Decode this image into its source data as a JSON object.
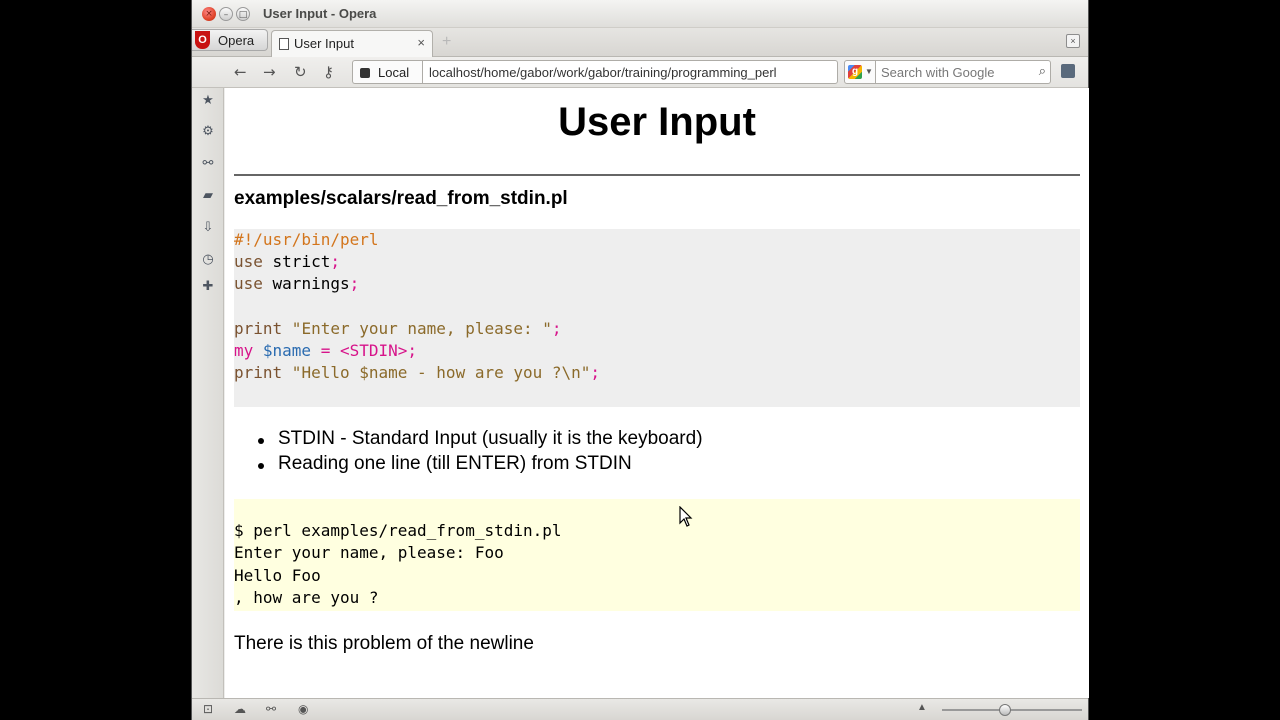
{
  "window": {
    "title": "User Input - Opera",
    "close_glyph": "×",
    "min_glyph": "–",
    "max_glyph": "□"
  },
  "tabs": {
    "menu_label": "Opera",
    "active_tab_label": "User Input",
    "close_glyph": "×",
    "new_tab_glyph": "+",
    "panel_glyph": "×"
  },
  "toolbar": {
    "back_icon": "←",
    "forward_icon": "→",
    "reload_icon": "↻",
    "key_icon": "⚷",
    "security_label": "Local",
    "url": "localhost/home/gabor/work/gabor/training/programming_perl",
    "search_placeholder": "Search with Google",
    "search_icon": "⌕",
    "engine_glyph": "g",
    "engine_arrow": "▼"
  },
  "sidebar": {
    "icons": [
      {
        "name": "bookmarks-star-icon",
        "glyph": "★"
      },
      {
        "name": "settings-gear-icon",
        "glyph": "⚙"
      },
      {
        "name": "unite-share-icon",
        "glyph": "⚯"
      },
      {
        "name": "notes-icon",
        "glyph": "▰"
      },
      {
        "name": "downloads-icon",
        "glyph": "⇩"
      },
      {
        "name": "history-clock-icon",
        "glyph": "◷"
      },
      {
        "name": "add-panel-icon",
        "glyph": "✚"
      }
    ]
  },
  "page": {
    "title": "User Input",
    "file_heading": "examples/scalars/read_from_stdin.pl",
    "code": {
      "shebang": "#!/usr/bin/perl",
      "line2_kw": "use",
      "line2_rest": " strict",
      "line3_kw": "use",
      "line3_rest": " warnings",
      "line5_kw": "print",
      "line5_str": " \"Enter your name, please: \"",
      "line6_kw": "my",
      "line6_var": " $name",
      "line6_rest": " = <STDIN>",
      "line7_kw": "print",
      "line7_str": " \"Hello $name - how are you ?\\n\"",
      "semicolon": ";"
    },
    "bullets": [
      "STDIN - Standard Input (usually it is the keyboard)",
      "Reading one line (till ENTER) from STDIN"
    ],
    "output": [
      "$ perl examples/read_from_stdin.pl",
      "Enter your name, please: Foo",
      "Hello Foo",
      ", how are you ?"
    ],
    "note": "There is this problem of the newline"
  },
  "statusbar": {
    "icons": [
      {
        "name": "panel-toggle-icon",
        "glyph": "⊡"
      },
      {
        "name": "turbo-cloud-icon",
        "glyph": "☁"
      },
      {
        "name": "unite-status-icon",
        "glyph": "⚯"
      },
      {
        "name": "speed-dial-icon",
        "glyph": "◉"
      }
    ],
    "zoom_arrow": "▲",
    "zoom_level": 0.45
  },
  "colors": {
    "code_background": "#eeeeee",
    "output_background": "#ffffe0",
    "comment": "#d3751c",
    "keyword": "#7a5230",
    "string": "#8b6a2a",
    "punctuation": "#d7138a",
    "variable": "#2a6bb0"
  }
}
